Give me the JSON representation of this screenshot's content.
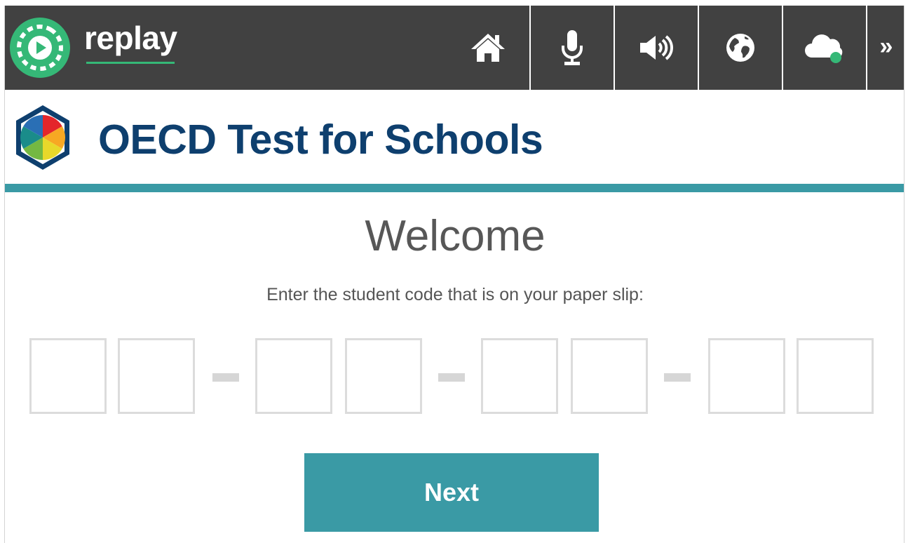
{
  "app": {
    "brand": "replay",
    "brand_color": "#35b877",
    "topbar_color": "#414141"
  },
  "toolbar": {
    "items": [
      {
        "icon": "home-icon"
      },
      {
        "icon": "microphone-icon"
      },
      {
        "icon": "speaker-icon"
      },
      {
        "icon": "globe-icon"
      },
      {
        "icon": "cloud-status-icon",
        "status_color": "#35b877"
      },
      {
        "icon": "double-chevron-right-icon",
        "glyph": "»"
      }
    ]
  },
  "header": {
    "title": "OECD Test for Schools",
    "title_color": "#0e3f6e",
    "rule_color": "#3a9aa5"
  },
  "main": {
    "heading": "Welcome",
    "instruction": "Enter the student code that is on your paper slip:",
    "code": {
      "groups": 4,
      "chars_per_group": 2,
      "values": [
        "",
        "",
        "",
        "",
        "",
        "",
        "",
        ""
      ]
    },
    "next_label": "Next",
    "accent_color": "#3a9aa5"
  }
}
